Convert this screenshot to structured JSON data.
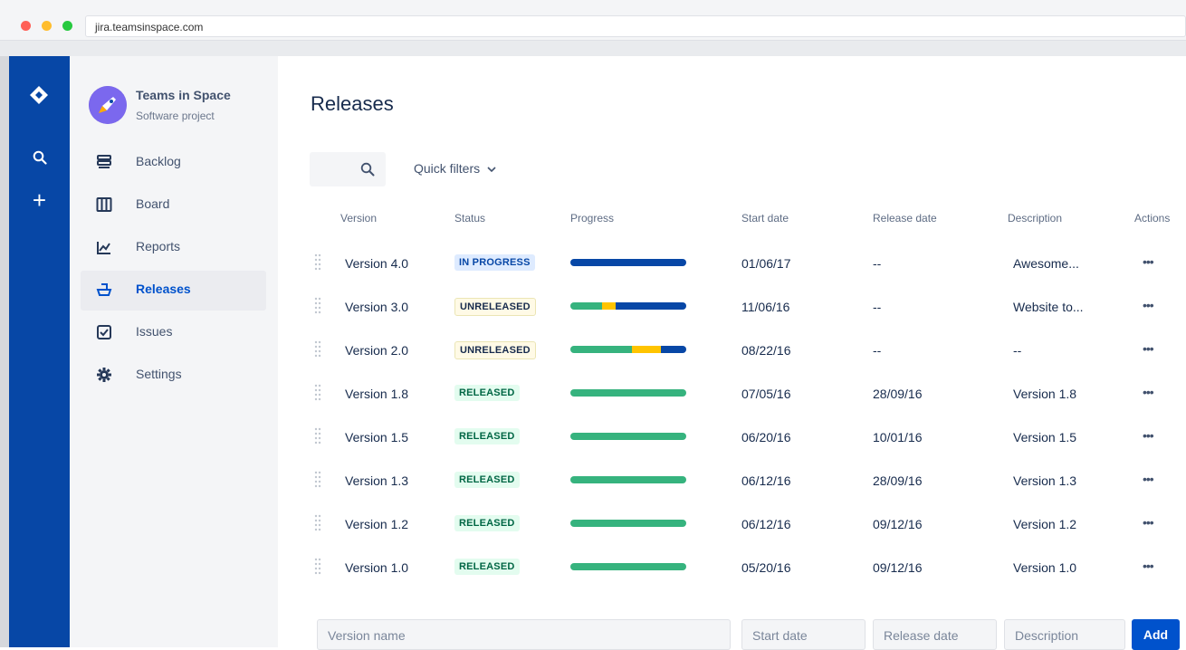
{
  "browser": {
    "url": "jira.teamsinspace.com"
  },
  "project": {
    "name": "Teams in Space",
    "type": "Software project"
  },
  "sidebar": {
    "items": [
      {
        "label": "Backlog",
        "icon": "backlog-icon"
      },
      {
        "label": "Board",
        "icon": "board-icon"
      },
      {
        "label": "Reports",
        "icon": "reports-icon"
      },
      {
        "label": "Releases",
        "icon": "releases-icon",
        "active": true
      },
      {
        "label": "Issues",
        "icon": "issues-icon"
      },
      {
        "label": "Settings",
        "icon": "gear-icon"
      }
    ]
  },
  "page": {
    "title": "Releases",
    "quick_filters": "Quick filters"
  },
  "table": {
    "headers": [
      "Version",
      "Status",
      "Progress",
      "Start date",
      "Release date",
      "Description",
      "Actions"
    ],
    "rows": [
      {
        "version": "Version 4.0",
        "status": "IN PROGRESS",
        "status_kind": "inprogress",
        "progress": {
          "done": 0,
          "in_progress": 0,
          "todo": 1
        },
        "start": "01/06/17",
        "release": "--",
        "description": "Awesome...",
        "actions": "•••"
      },
      {
        "version": "Version 3.0",
        "status": "UNRELEASED",
        "status_kind": "unreleased",
        "progress": {
          "done": 0.27,
          "in_progress": 0.12,
          "todo": 0.61
        },
        "start": "11/06/16",
        "release": "--",
        "description": "Website to...",
        "actions": "•••"
      },
      {
        "version": "Version 2.0",
        "status": "UNRELEASED",
        "status_kind": "unreleased",
        "progress": {
          "done": 0.53,
          "in_progress": 0.25,
          "todo": 0.22
        },
        "start": "08/22/16",
        "release": "--",
        "description": "--",
        "actions": "•••"
      },
      {
        "version": "Version 1.8",
        "status": "RELEASED",
        "status_kind": "released",
        "progress": {
          "done": 1,
          "in_progress": 0,
          "todo": 0
        },
        "start": "07/05/16",
        "release": "28/09/16",
        "description": "Version 1.8",
        "actions": "•••"
      },
      {
        "version": "Version 1.5",
        "status": "RELEASED",
        "status_kind": "released",
        "progress": {
          "done": 1,
          "in_progress": 0,
          "todo": 0
        },
        "start": "06/20/16",
        "release": "10/01/16",
        "description": "Version 1.5",
        "actions": "•••"
      },
      {
        "version": "Version 1.3",
        "status": "RELEASED",
        "status_kind": "released",
        "progress": {
          "done": 1,
          "in_progress": 0,
          "todo": 0
        },
        "start": "06/12/16",
        "release": "28/09/16",
        "description": "Version 1.3",
        "actions": "•••"
      },
      {
        "version": "Version 1.2",
        "status": "RELEASED",
        "status_kind": "released",
        "progress": {
          "done": 1,
          "in_progress": 0,
          "todo": 0
        },
        "start": "06/12/16",
        "release": "09/12/16",
        "description": "Version 1.2",
        "actions": "•••"
      },
      {
        "version": "Version 1.0",
        "status": "RELEASED",
        "status_kind": "released",
        "progress": {
          "done": 1,
          "in_progress": 0,
          "todo": 0
        },
        "start": "05/20/16",
        "release": "09/12/16",
        "description": "Version 1.0",
        "actions": "•••"
      }
    ]
  },
  "form": {
    "version_placeholder": "Version name",
    "start_placeholder": "Start date",
    "release_placeholder": "Release date",
    "description_placeholder": "Description",
    "add_label": "Add"
  },
  "colors": {
    "brand": "#0747a6",
    "done": "#36b37e",
    "in_progress": "#ffc400",
    "todo": "#0747a6",
    "primary_button": "#0052cc"
  }
}
